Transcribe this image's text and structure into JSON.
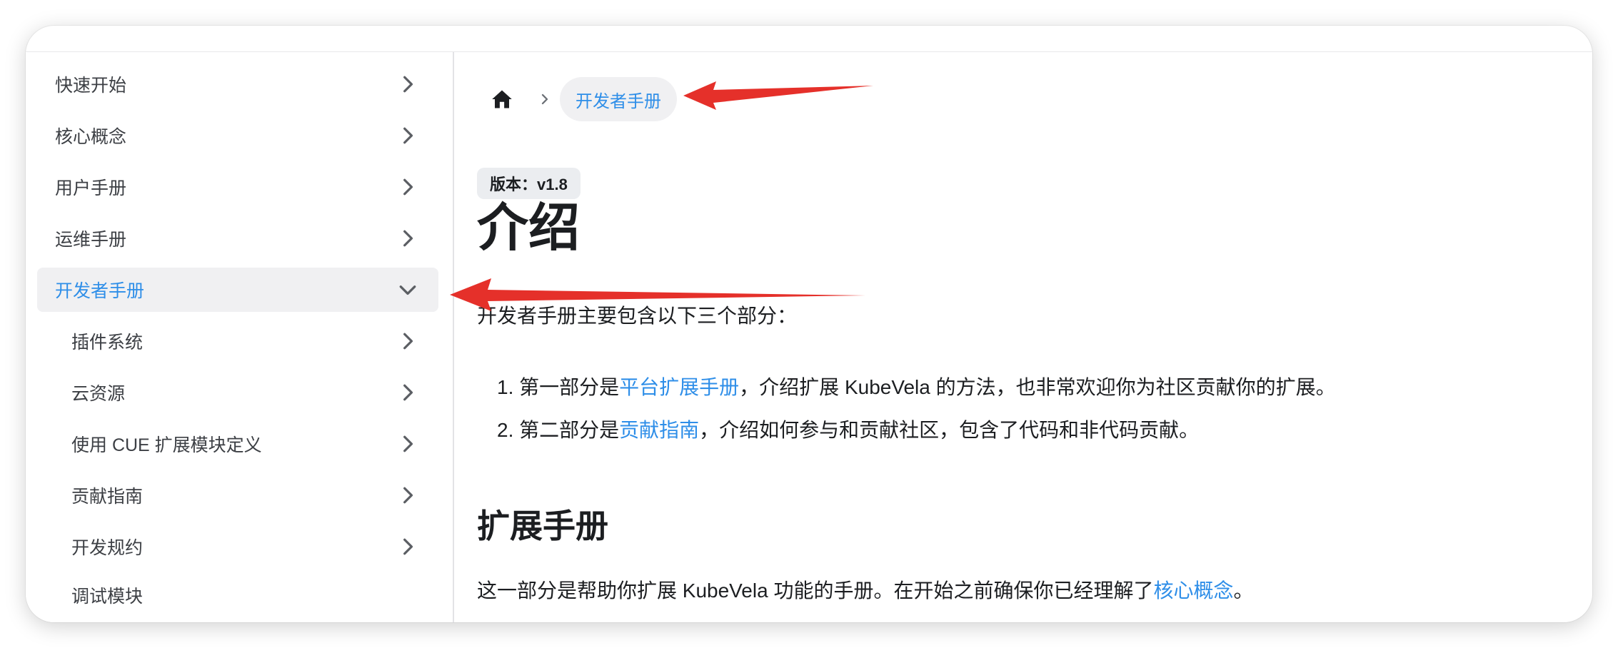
{
  "sidebar": {
    "items": [
      {
        "label": "快速开始",
        "expanded": false,
        "active": false,
        "level": 1
      },
      {
        "label": "核心概念",
        "expanded": false,
        "active": false,
        "level": 1
      },
      {
        "label": "用户手册",
        "expanded": false,
        "active": false,
        "level": 1
      },
      {
        "label": "运维手册",
        "expanded": false,
        "active": false,
        "level": 1
      },
      {
        "label": "开发者手册",
        "expanded": true,
        "active": true,
        "level": 1
      },
      {
        "label": "插件系统",
        "expanded": false,
        "active": false,
        "level": 2
      },
      {
        "label": "云资源",
        "expanded": false,
        "active": false,
        "level": 2
      },
      {
        "label": "使用 CUE 扩展模块定义",
        "expanded": false,
        "active": false,
        "level": 2
      },
      {
        "label": "贡献指南",
        "expanded": false,
        "active": false,
        "level": 2
      },
      {
        "label": "开发规约",
        "expanded": false,
        "active": false,
        "level": 2
      },
      {
        "label": "调试模块",
        "expanded": false,
        "active": false,
        "level": 2
      }
    ]
  },
  "breadcrumb": {
    "home_icon": "home-icon",
    "separator_icon": "chevron-right-icon",
    "current": "开发者手册"
  },
  "doc": {
    "version_badge": "版本：v1.8",
    "title": "介绍",
    "intro": "开发者手册主要包含以下三个部分：",
    "list": [
      {
        "number": "1.",
        "before": "第一部分是",
        "link": "平台扩展手册",
        "after": "，介绍扩展 KubeVela 的方法，也非常欢迎你为社区贡献你的扩展。"
      },
      {
        "number": "2.",
        "before": "第二部分是",
        "link": "贡献指南",
        "after": "，介绍如何参与和贡献社区，包含了代码和非代码贡献。"
      }
    ],
    "section_title": "扩展手册",
    "section_text_before": "这一部分是帮助你扩展 KubeVela 功能的手册。在开始之前确保你已经理解了",
    "section_link": "核心概念",
    "section_text_after": "。"
  },
  "colors": {
    "accent": "#2e8ee8",
    "annotation_arrow": "#e5302a",
    "active_bg": "#f0f0f2"
  }
}
